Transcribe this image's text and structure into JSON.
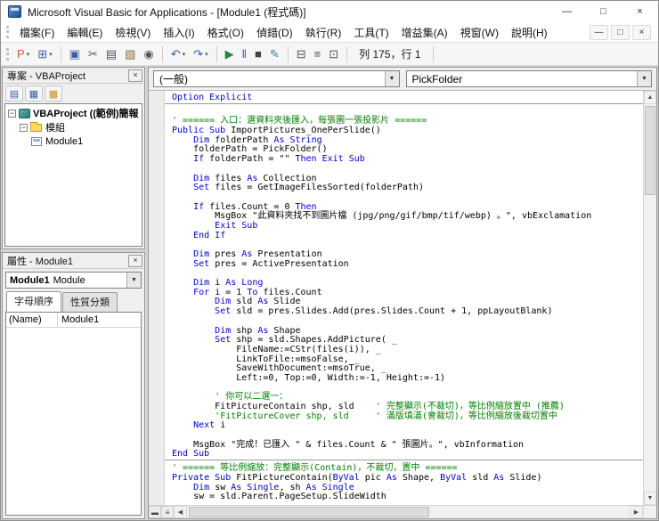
{
  "window": {
    "title": "Microsoft Visual Basic for Applications - [Module1 (程式碼)]",
    "controls": [
      {
        "name": "minimize-button",
        "glyph": "—"
      },
      {
        "name": "maximize-button",
        "glyph": "□"
      },
      {
        "name": "close-button",
        "glyph": "×"
      }
    ]
  },
  "menu": {
    "items": [
      {
        "label": "檔案(F)"
      },
      {
        "label": "編輯(E)"
      },
      {
        "label": "檢視(V)"
      },
      {
        "label": "插入(I)"
      },
      {
        "label": "格式(O)"
      },
      {
        "label": "偵錯(D)"
      },
      {
        "label": "執行(R)"
      },
      {
        "label": "工具(T)"
      },
      {
        "label": "增益集(A)"
      },
      {
        "label": "視窗(W)"
      },
      {
        "label": "說明(H)"
      }
    ],
    "child_controls": [
      {
        "name": "child-minimize-button",
        "glyph": "—"
      },
      {
        "name": "child-restore-button",
        "glyph": "□"
      },
      {
        "name": "child-close-button",
        "glyph": "×"
      }
    ]
  },
  "toolbar": {
    "items": [
      {
        "type": "btn",
        "name": "view-host-app-button",
        "glyph": "P",
        "color": "#c7642c",
        "drop": true
      },
      {
        "type": "btn",
        "name": "insert-userform-button",
        "glyph": "⊞",
        "color": "#44639c",
        "drop": true
      },
      {
        "type": "sep"
      },
      {
        "type": "btn",
        "name": "save-button",
        "glyph": "▣",
        "color": "#3b5e9e"
      },
      {
        "type": "btn",
        "name": "cut-button",
        "glyph": "✂",
        "color": "#555555"
      },
      {
        "type": "btn",
        "name": "copy-button",
        "glyph": "▤",
        "color": "#555555"
      },
      {
        "type": "btn",
        "name": "paste-button",
        "glyph": "▧",
        "color": "#8a6d3b"
      },
      {
        "type": "btn",
        "name": "find-button",
        "glyph": "◉",
        "color": "#555555"
      },
      {
        "type": "sep"
      },
      {
        "type": "btn",
        "name": "undo-button",
        "glyph": "↶",
        "color": "#2b5fb8",
        "drop": true
      },
      {
        "type": "btn",
        "name": "redo-button",
        "glyph": "↷",
        "color": "#2b5fb8",
        "drop": true
      },
      {
        "type": "sep"
      },
      {
        "type": "btn",
        "name": "run-button",
        "glyph": "▶",
        "color": "#1e8a3c"
      },
      {
        "type": "btn",
        "name": "break-button",
        "glyph": "‖",
        "color": "#2b5fb8"
      },
      {
        "type": "btn",
        "name": "reset-button",
        "glyph": "■",
        "color": "#444444"
      },
      {
        "type": "btn",
        "name": "design-mode-button",
        "glyph": "✎",
        "color": "#3b7ea1"
      },
      {
        "type": "sep"
      },
      {
        "type": "btn",
        "name": "project-explorer-button",
        "glyph": "⊟",
        "color": "#555555"
      },
      {
        "type": "btn",
        "name": "properties-window-button",
        "glyph": "≡",
        "color": "#555555"
      },
      {
        "type": "btn",
        "name": "object-browser-button",
        "glyph": "⊡",
        "color": "#555555"
      },
      {
        "type": "sep"
      },
      {
        "type": "text",
        "name": "cursor-position",
        "label": "列 175，行 1"
      },
      {
        "type": "sep"
      }
    ]
  },
  "project_panel": {
    "title": "專案 - VBAProject",
    "close_glyph": "×",
    "toolbar": [
      {
        "name": "view-code-button",
        "glyph": "▤",
        "color": "#3b5e9e"
      },
      {
        "name": "view-object-button",
        "glyph": "▦",
        "color": "#3b5e9e"
      },
      {
        "name": "toggle-folders-button",
        "glyph": "▩",
        "color": "#c9941a"
      }
    ],
    "tree": [
      {
        "name": "tree-item-vbaproject",
        "label": "VBAProject ((範例)簡報",
        "level": 0,
        "icon": "project",
        "bold": true,
        "expander": "−"
      },
      {
        "name": "tree-item-modules-folder",
        "label": "模組",
        "level": 1,
        "icon": "folder",
        "expander": "−"
      },
      {
        "name": "tree-item-module1",
        "label": "Module1",
        "level": 2,
        "icon": "module"
      }
    ]
  },
  "properties_panel": {
    "title": "屬性 - Module1",
    "close_glyph": "×",
    "selector": {
      "object": "Module1",
      "type": "Module"
    },
    "tabs": [
      {
        "label": "字母順序"
      },
      {
        "label": "性質分類"
      }
    ],
    "rows": [
      {
        "name": "(Name)",
        "value": "Module1"
      }
    ]
  },
  "code_window": {
    "object_combo": "(一般)",
    "procedure_combo": "PickFolder",
    "colors": {
      "keyword": "#0000cc",
      "comment": "#008000",
      "text": "#000000"
    },
    "lines": [
      {
        "t": [
          [
            "k",
            "Option Explicit"
          ]
        ]
      },
      {
        "sep": true
      },
      {
        "t": []
      },
      {
        "t": [
          [
            "c",
            "' ====== 入口：選資料夾後匯入，每張圖一張投影片 ======"
          ]
        ]
      },
      {
        "t": [
          [
            "k",
            "Public Sub "
          ],
          [
            "n",
            "ImportPictures_OnePerSlide()"
          ]
        ]
      },
      {
        "t": [
          [
            "n",
            "    "
          ],
          [
            "k",
            "Dim "
          ],
          [
            "n",
            "folderPath "
          ],
          [
            "k",
            "As String"
          ]
        ]
      },
      {
        "t": [
          [
            "n",
            "    folderPath = PickFolder()"
          ]
        ]
      },
      {
        "t": [
          [
            "n",
            "    "
          ],
          [
            "k",
            "If "
          ],
          [
            "n",
            "folderPath = \"\" "
          ],
          [
            "k",
            "Then Exit Sub"
          ]
        ]
      },
      {
        "t": []
      },
      {
        "t": [
          [
            "n",
            "    "
          ],
          [
            "k",
            "Dim "
          ],
          [
            "n",
            "files "
          ],
          [
            "k",
            "As "
          ],
          [
            "n",
            "Collection"
          ]
        ]
      },
      {
        "t": [
          [
            "n",
            "    "
          ],
          [
            "k",
            "Set "
          ],
          [
            "n",
            "files = GetImageFilesSorted(folderPath)"
          ]
        ]
      },
      {
        "t": []
      },
      {
        "t": [
          [
            "n",
            "    "
          ],
          [
            "k",
            "If "
          ],
          [
            "n",
            "files.Count = 0 "
          ],
          [
            "k",
            "Then"
          ]
        ]
      },
      {
        "t": [
          [
            "n",
            "        MsgBox \"此資料夾找不到圖片檔 (jpg/png/gif/bmp/tif/webp) 。\", vbExclamation"
          ]
        ]
      },
      {
        "t": [
          [
            "n",
            "        "
          ],
          [
            "k",
            "Exit Sub"
          ]
        ]
      },
      {
        "t": [
          [
            "n",
            "    "
          ],
          [
            "k",
            "End If"
          ]
        ]
      },
      {
        "t": []
      },
      {
        "t": [
          [
            "n",
            "    "
          ],
          [
            "k",
            "Dim "
          ],
          [
            "n",
            "pres "
          ],
          [
            "k",
            "As "
          ],
          [
            "n",
            "Presentation"
          ]
        ]
      },
      {
        "t": [
          [
            "n",
            "    "
          ],
          [
            "k",
            "Set "
          ],
          [
            "n",
            "pres = ActivePresentation"
          ]
        ]
      },
      {
        "t": []
      },
      {
        "t": [
          [
            "n",
            "    "
          ],
          [
            "k",
            "Dim "
          ],
          [
            "n",
            "i "
          ],
          [
            "k",
            "As Long"
          ]
        ]
      },
      {
        "t": [
          [
            "n",
            "    "
          ],
          [
            "k",
            "For "
          ],
          [
            "n",
            "i = 1 "
          ],
          [
            "k",
            "To "
          ],
          [
            "n",
            "files.Count"
          ]
        ]
      },
      {
        "t": [
          [
            "n",
            "        "
          ],
          [
            "k",
            "Dim "
          ],
          [
            "n",
            "sld "
          ],
          [
            "k",
            "As "
          ],
          [
            "n",
            "Slide"
          ]
        ]
      },
      {
        "t": [
          [
            "n",
            "        "
          ],
          [
            "k",
            "Set "
          ],
          [
            "n",
            "sld = pres.Slides.Add(pres.Slides.Count + 1, ppLayoutBlank)"
          ]
        ]
      },
      {
        "t": []
      },
      {
        "t": [
          [
            "n",
            "        "
          ],
          [
            "k",
            "Dim "
          ],
          [
            "n",
            "shp "
          ],
          [
            "k",
            "As "
          ],
          [
            "n",
            "Shape"
          ]
        ]
      },
      {
        "t": [
          [
            "n",
            "        "
          ],
          [
            "k",
            "Set "
          ],
          [
            "n",
            "shp = sld.Shapes.AddPicture( _"
          ]
        ]
      },
      {
        "t": [
          [
            "n",
            "            FileName:=CStr(files(i)), _"
          ]
        ]
      },
      {
        "t": [
          [
            "n",
            "            LinkToFile:=msoFalse, _"
          ]
        ]
      },
      {
        "t": [
          [
            "n",
            "            SaveWithDocument:=msoTrue, _"
          ]
        ]
      },
      {
        "t": [
          [
            "n",
            "            Left:=0, Top:=0, Width:=-1, Height:=-1)"
          ]
        ]
      },
      {
        "t": []
      },
      {
        "t": [
          [
            "n",
            "        "
          ],
          [
            "c",
            "' 你可以二選一："
          ]
        ]
      },
      {
        "t": [
          [
            "n",
            "        FitPictureContain shp, sld    "
          ],
          [
            "c",
            "' 完整顯示(不裁切)，等比例縮放置中 (推薦)"
          ]
        ]
      },
      {
        "t": [
          [
            "n",
            "        "
          ],
          [
            "c",
            "'FitPictureCover shp, sld     ' 滿版填滿(會裁切)，等比例縮放後裁切置中"
          ]
        ]
      },
      {
        "t": [
          [
            "n",
            "    "
          ],
          [
            "k",
            "Next "
          ],
          [
            "n",
            "i"
          ]
        ]
      },
      {
        "t": []
      },
      {
        "t": [
          [
            "n",
            "    MsgBox \"完成！已匯入 \" & files.Count & \" 張圖片。\", vbInformation"
          ]
        ]
      },
      {
        "t": [
          [
            "k",
            "End Sub"
          ]
        ]
      },
      {
        "sep": true
      },
      {
        "t": [
          [
            "c",
            "' ====== 等比例縮放：完整顯示(Contain)，不裁切，置中 ======"
          ]
        ]
      },
      {
        "t": [
          [
            "k",
            "Private Sub "
          ],
          [
            "n",
            "FitPictureContain("
          ],
          [
            "k",
            "ByVal "
          ],
          [
            "n",
            "pic "
          ],
          [
            "k",
            "As "
          ],
          [
            "n",
            "Shape, "
          ],
          [
            "k",
            "ByVal "
          ],
          [
            "n",
            "sld "
          ],
          [
            "k",
            "As "
          ],
          [
            "n",
            "Slide)"
          ]
        ]
      },
      {
        "t": [
          [
            "n",
            "    "
          ],
          [
            "k",
            "Dim "
          ],
          [
            "n",
            "sw "
          ],
          [
            "k",
            "As Single"
          ],
          [
            "n",
            ", sh "
          ],
          [
            "k",
            "As Single"
          ]
        ]
      },
      {
        "t": [
          [
            "n",
            "    sw = sld.Parent.PageSetup.SlideWidth"
          ]
        ]
      }
    ]
  },
  "icons": {
    "combo_arrow": "▼",
    "scroll_up": "▲",
    "scroll_down": "▼",
    "scroll_left": "◀",
    "scroll_right": "▶",
    "procedure_view": "▬",
    "full_module_view": "≡"
  }
}
